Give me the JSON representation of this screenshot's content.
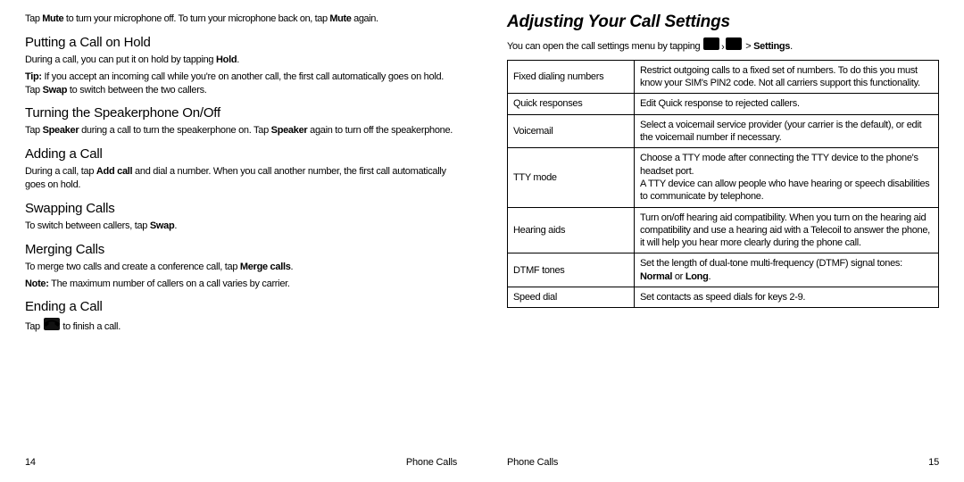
{
  "left": {
    "intro": "Tap <b>Mute</b> to turn your microphone off. To turn your microphone back on, tap <b>Mute</b> again.",
    "sections": [
      {
        "h": "Putting a Call on Hold",
        "p": [
          "During a call, you can put it on hold by tapping <b>Hold</b>.",
          "<b>Tip:</b> If you accept an incoming call while you're on another call, the first call automatically goes on hold. Tap <b>Swap</b> to switch between the two callers."
        ]
      },
      {
        "h": "Turning the Speakerphone On/Off",
        "p": [
          "Tap <b>Speaker</b> during a call to turn the speakerphone on. Tap <b>Speaker</b> again to turn off the speakerphone."
        ]
      },
      {
        "h": "Adding a Call",
        "p": [
          "During a call, tap <b>Add call</b> and dial a number. When you call another number, the first call automatically goes on hold."
        ]
      },
      {
        "h": "Swapping Calls",
        "p": [
          "To switch between callers, tap <b>Swap</b>."
        ]
      },
      {
        "h": "Merging Calls",
        "p": [
          "To merge two calls and create a conference call, tap <b>Merge calls</b>.",
          "<b>Note:</b> The maximum number of callers on a call varies by carrier."
        ]
      },
      {
        "h": "Ending a Call",
        "p_pre": "Tap ",
        "p_post": " to finish a call."
      }
    ],
    "footer": {
      "left": "14",
      "right": "Phone Calls"
    }
  },
  "right": {
    "title": "Adjusting Your Call Settings",
    "intro_pre": "You can open the call settings menu by tapping ",
    "intro_post": " > <b>Settings</b>.",
    "table": [
      {
        "k": "Fixed dialing numbers",
        "v": "Restrict outgoing calls to a fixed set of numbers. To do this you must know your SIM's PIN2 code. Not all carriers support this functionality."
      },
      {
        "k": "Quick responses",
        "v": "Edit Quick response to rejected callers."
      },
      {
        "k": "Voicemail",
        "v": "Select a voicemail service provider (your carrier is the default), or edit the voicemail number if necessary."
      },
      {
        "k": "TTY mode",
        "v": "Choose a TTY mode after connecting the TTY device to the phone's headset port.<br>A TTY device can allow people who have hearing or speech disabilities to communicate by telephone."
      },
      {
        "k": "Hearing aids",
        "v": "Turn on/off hearing aid compatibility. When you turn on the hearing aid compatibility and use a hearing aid with a Telecoil to answer the phone, it will help you hear more clearly during the phone call."
      },
      {
        "k": "DTMF tones",
        "v": "Set the length of dual-tone multi-frequency (DTMF) signal tones: <b>Normal</b> or <b>Long</b>."
      },
      {
        "k": "Speed dial",
        "v": "Set contacts as speed dials for keys 2-9."
      }
    ],
    "footer": {
      "left": "Phone Calls",
      "right": "15"
    }
  }
}
